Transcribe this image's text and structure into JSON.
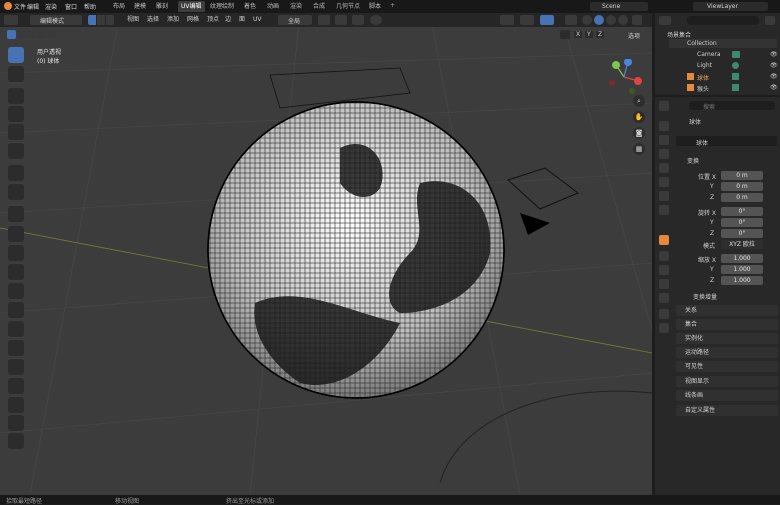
{
  "menubar": {
    "items": [
      "文件",
      "编辑",
      "渲染",
      "窗口",
      "帮助"
    ],
    "workspaces": [
      "布局",
      "建模",
      "雕刻",
      "UV编辑",
      "纹理绘制",
      "着色",
      "动画",
      "渲染",
      "合成",
      "几何节点",
      "脚本"
    ],
    "active_workspace": "UV编辑",
    "scene": "Scene",
    "view_layer": "ViewLayer"
  },
  "viewport_header": {
    "mode": "编辑模式",
    "menus": [
      "视图",
      "选择",
      "添加",
      "网格",
      "顶点",
      "边",
      "面",
      "UV"
    ],
    "transform_orientation": "全局",
    "axes": [
      "X",
      "Y",
      "Z"
    ],
    "shading_mode": "选项"
  },
  "viewport": {
    "view_name": "用户透视",
    "object_info": "(0) 球体",
    "gizmo_axes": [
      "X",
      "Y",
      "Z"
    ]
  },
  "outliner": {
    "search_placeholder": "",
    "root": "场景集合",
    "collection": "Collection",
    "items": [
      "Camera",
      "Light",
      "球体",
      "猴头"
    ]
  },
  "properties": {
    "search_placeholder": "搜索",
    "object_name": "球体",
    "object_field": "球体",
    "transform_header": "变换",
    "location_label": "位置 X",
    "location": [
      "0 m",
      "0 m",
      "0 m"
    ],
    "rotation_label": "旋转 X",
    "rotation": [
      "0°",
      "0°",
      "0°"
    ],
    "mode_label": "模式",
    "mode_value": "XYZ 欧拉",
    "scale_label": "缩放 X",
    "scale": [
      "1.000",
      "1.000",
      "1.000"
    ],
    "axis_y": "Y",
    "axis_z": "Z",
    "delta_transform": "变换增量",
    "sections": [
      "关系",
      "集合",
      "实例化",
      "运动路径",
      "可见性",
      "视图显示",
      "线条画",
      "自定义属性"
    ]
  },
  "statusbar": {
    "left": "拾取最短路径",
    "middle": "移动视图",
    "right": "挤出至光标或添加"
  },
  "colors": {
    "accent": "#4772b3",
    "viewport_bg": "#3c3c3c",
    "panel_bg": "#282828",
    "orange": "#e8883a"
  }
}
